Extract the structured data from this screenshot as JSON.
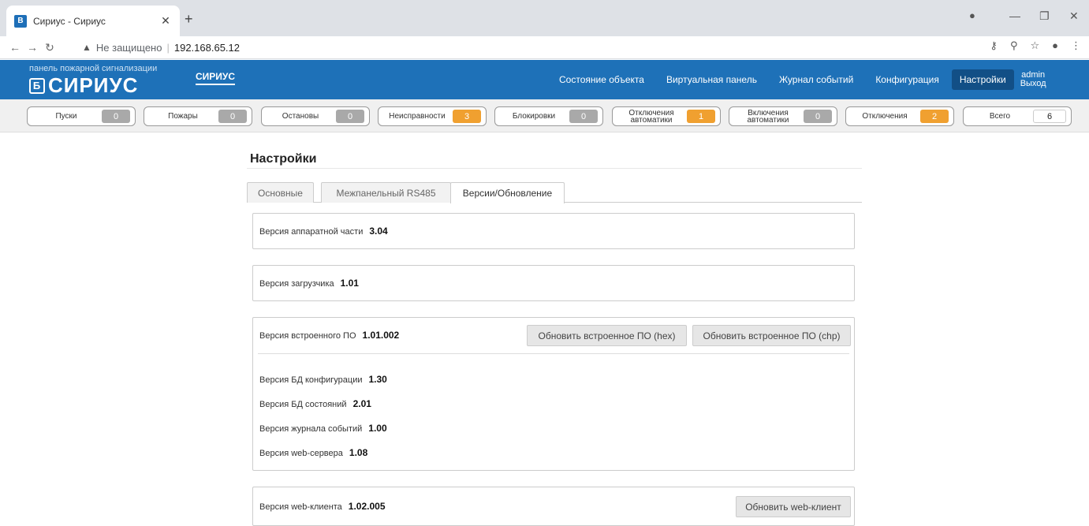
{
  "browser": {
    "tab_title": "Сириус - Сириус",
    "favicon_letter": "B",
    "insecure_label": "Не защищено",
    "url": "192.168.65.12"
  },
  "header": {
    "logo_sub": "панель пожарной сигнализации",
    "logo_main": "СИРИУС",
    "device_name": "СИРИУС",
    "nav": [
      "Состояние объекта",
      "Виртуальная панель",
      "Журнал событий",
      "Конфигурация",
      "Настройки"
    ],
    "active_nav": "Настройки",
    "user": "admin",
    "logout": "Выход"
  },
  "counters": [
    {
      "label": "Пуски",
      "value": "0",
      "color": "gray"
    },
    {
      "label": "Пожары",
      "value": "0",
      "color": "gray"
    },
    {
      "label": "Остановы",
      "value": "0",
      "color": "gray"
    },
    {
      "label": "Неисправности",
      "value": "3",
      "color": "orange"
    },
    {
      "label": "Блокировки",
      "value": "0",
      "color": "gray"
    },
    {
      "label": "Отключения автоматики",
      "value": "1",
      "color": "orange"
    },
    {
      "label": "Включения автоматики",
      "value": "0",
      "color": "gray"
    },
    {
      "label": "Отключения",
      "value": "2",
      "color": "orange"
    },
    {
      "label": "Всего",
      "value": "6",
      "color": "white"
    }
  ],
  "page": {
    "title": "Настройки",
    "tabs": [
      "Основные",
      "Межпанельный RS485",
      "Версии/Обновление"
    ],
    "active_tab": "Версии/Обновление",
    "hw": {
      "label": "Версия аппаратной части",
      "value": "3.04"
    },
    "bootloader": {
      "label": "Версия загрузчика",
      "value": "1.01"
    },
    "firmware": {
      "label": "Версия встроенного ПО",
      "value": "1.01.002",
      "btn_hex": "Обновить встроенное ПО (hex)",
      "btn_chp": "Обновить встроенное ПО (chp)"
    },
    "sub_versions": [
      {
        "label": "Версия БД конфигурации",
        "value": "1.30"
      },
      {
        "label": "Версия БД состояний",
        "value": "2.01"
      },
      {
        "label": "Версия журнала событий",
        "value": "1.00"
      },
      {
        "label": "Версия web-сервера",
        "value": "1.08"
      }
    ],
    "webclient": {
      "label": "Версия web-клиента",
      "value": "1.02.005",
      "btn": "Обновить web-клиент"
    }
  },
  "colors": {
    "accent": "#1e71b8",
    "active_nav": "#124f86",
    "badge_orange": "#f0a030",
    "badge_gray": "#a9a9a9"
  }
}
